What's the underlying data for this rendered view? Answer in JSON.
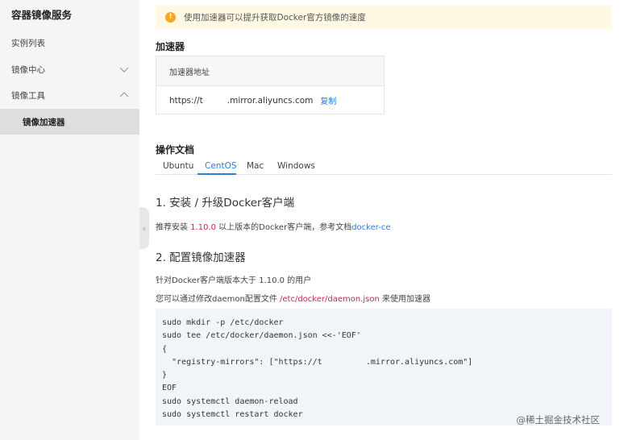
{
  "sidebar": {
    "title": "容器镜像服务",
    "items": [
      {
        "label": "实例列表"
      },
      {
        "label": "镜像中心",
        "chevron": "chevron-down-icon"
      },
      {
        "label": "镜像工具",
        "chevron": "chevron-up-icon"
      },
      {
        "label": "镜像加速器"
      }
    ],
    "toggle_glyph": "‹"
  },
  "notice": {
    "icon": "!",
    "text": "使用加速器可以提升获取Docker官方镜像的速度"
  },
  "accelerator": {
    "heading": "加速器",
    "column_header": "加速器地址",
    "url": "https://t         .mirror.aliyuncs.com",
    "copy_label": "复制"
  },
  "docs": {
    "heading": "操作文档",
    "tabs": [
      "Ubuntu",
      "CentOS",
      "Mac",
      "Windows"
    ],
    "active_tab": "CentOS",
    "step1": {
      "title": "1. 安装 / 升级Docker客户端",
      "text_prefix": "推荐安装 ",
      "version": "1.10.0",
      "text_middle": " 以上版本的Docker客户端，参考文档",
      "link": "docker-ce"
    },
    "step2": {
      "title": "2. 配置镜像加速器",
      "line1": "针对Docker客户端版本大于 1.10.0 的用户",
      "line2_prefix": "您可以通过修改daemon配置文件 ",
      "line2_path": "/etc/docker/daemon.json",
      "line2_suffix": " 来使用加速器"
    },
    "code_lines": [
      "sudo mkdir -p /etc/docker",
      "sudo tee /etc/docker/daemon.json <<-'EOF'",
      "{",
      "  \"registry-mirrors\": [\"https://t         .mirror.aliyuncs.com\"]",
      "}",
      "EOF",
      "sudo systemctl daemon-reload",
      "sudo systemctl restart docker"
    ]
  },
  "watermark": "@稀土掘金技术社区",
  "colors": {
    "accent": "#2d7cd6",
    "warning": "#f5a623",
    "highlight": "#c7254e"
  }
}
